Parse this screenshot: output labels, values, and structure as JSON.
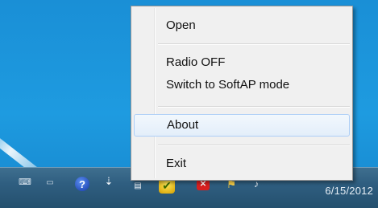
{
  "menu": {
    "items": [
      {
        "label": "Open"
      },
      {
        "label": "Radio OFF"
      },
      {
        "label": "Switch to SoftAP mode"
      },
      {
        "label": "About"
      },
      {
        "label": "Exit"
      }
    ],
    "highlighted": "About"
  },
  "taskbar": {
    "clock": "6/15/2012",
    "icons": [
      "keyboard-icon",
      "language-icon",
      "help-icon",
      "usb-icon",
      "network-icon",
      "security-shield-icon",
      "stop-icon",
      "flag-icon",
      "speaker-icon"
    ]
  },
  "colors": {
    "desktop": "#1e9be0",
    "taskbar": "#2f5e80",
    "menu_bg": "#f0f0f0",
    "highlight": "#e3eefa"
  }
}
